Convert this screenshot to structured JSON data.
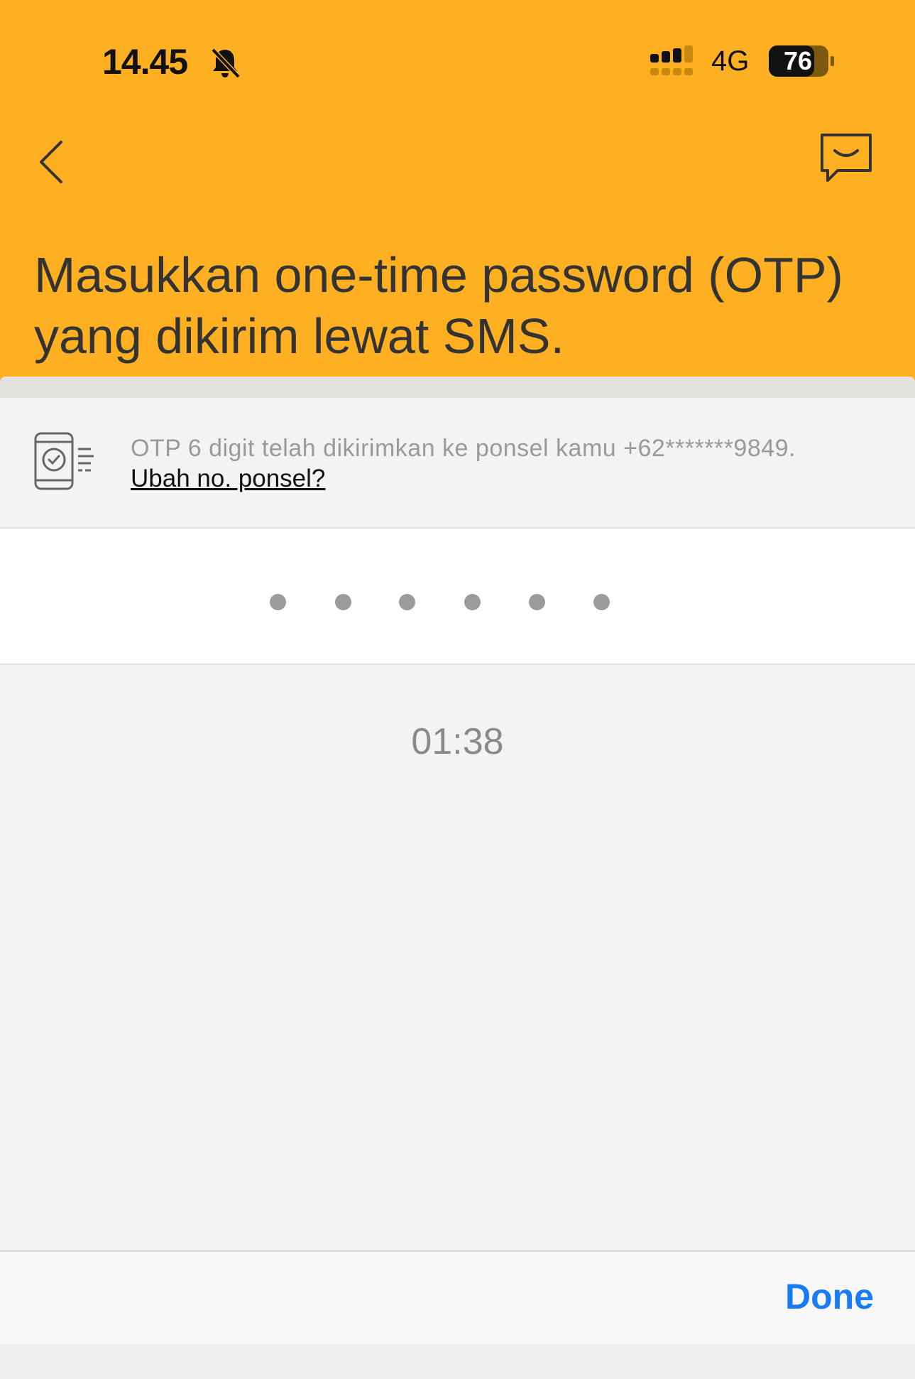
{
  "status_bar": {
    "time": "14.45",
    "network": "4G",
    "battery": "76"
  },
  "header": {
    "title": "Masukkan one-time password (OTP) yang dikirim lewat SMS."
  },
  "info": {
    "message": "OTP 6 digit telah dikirimkan ke ponsel kamu +62*******9849.",
    "change_number_link": "Ubah no. ponsel?"
  },
  "otp": {
    "length": 6,
    "filled": 0
  },
  "timer": "01:38",
  "keyboard_bar": {
    "done_label": "Done"
  },
  "colors": {
    "header_bg": "#feb022",
    "accent_done": "#1a7cf5",
    "dot": "#9b9b9b"
  },
  "icons": [
    "bell-muted-icon",
    "signal-icon",
    "battery-icon",
    "back-chevron-icon",
    "chat-support-icon",
    "phone-check-icon"
  ]
}
